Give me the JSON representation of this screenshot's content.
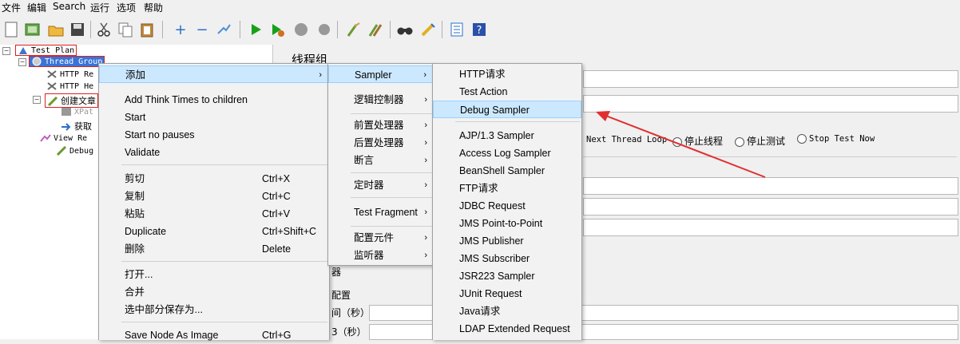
{
  "menubar": [
    "文件",
    "编辑",
    "Search",
    "运行",
    "选项",
    "帮助"
  ],
  "toolbar_icons": [
    "new-icon",
    "templates-icon",
    "open-icon",
    "save-icon",
    "cut-icon",
    "copy-icon",
    "paste-icon",
    "expand-icon",
    "collapse-icon",
    "toggle-icon",
    "start-icon",
    "start-no-pauses-icon",
    "stop-icon",
    "shutdown-icon",
    "clear-icon",
    "clear-all-icon",
    "search-icon",
    "reset-search-icon",
    "function-helper-icon",
    "help-icon"
  ],
  "tree": {
    "test_plan": "Test Plan",
    "thread_group": "Thread Group",
    "http_req": "HTTP Re",
    "http_hea": "HTTP He",
    "create_article": "创建文章",
    "xpath": "XPat",
    "fetch": "获取",
    "view_results": "View Re",
    "debug_sampler": "Debug S"
  },
  "right_panel": {
    "title": "线程组",
    "next_loop": "Next Thread Loop",
    "stop_thread": "停止线程",
    "stop_test": "停止测试",
    "stop_test_now": "Stop Test Now",
    "label_1": "器",
    "label_2": "配置",
    "label_3": "间（秒）",
    "label_4": "3（秒）"
  },
  "context_menu": {
    "add": "添加",
    "add_think_times": "Add Think Times to children",
    "start": "Start",
    "start_no_pauses": "Start no pauses",
    "validate": "Validate",
    "cut": "剪切",
    "cut_sc": "Ctrl+X",
    "copy": "复制",
    "copy_sc": "Ctrl+C",
    "paste": "粘贴",
    "paste_sc": "Ctrl+V",
    "duplicate": "Duplicate",
    "duplicate_sc": "Ctrl+Shift+C",
    "delete": "删除",
    "delete_sc": "Delete",
    "open": "打开...",
    "merge": "合并",
    "save_selection": "选中部分保存为...",
    "save_node_image": "Save Node As Image",
    "save_node_image_sc": "Ctrl+G"
  },
  "add_menu": {
    "sampler": "Sampler",
    "logic": "逻辑控制器",
    "pre": "前置处理器",
    "post": "后置处理器",
    "assert": "断言",
    "timer": "定时器",
    "fragment": "Test Fragment",
    "config": "配置元件",
    "listener": "监听器"
  },
  "sampler_menu": {
    "items": [
      "HTTP请求",
      "Test Action",
      "Debug Sampler",
      "AJP/1.3 Sampler",
      "Access Log Sampler",
      "BeanShell Sampler",
      "FTP请求",
      "JDBC Request",
      "JMS Point-to-Point",
      "JMS Publisher",
      "JMS Subscriber",
      "JSR223 Sampler",
      "JUnit Request",
      "Java请求",
      "LDAP Extended Request"
    ]
  },
  "colors": {
    "highlight": "#cce8ff",
    "selection": "#3874d8",
    "annotation": "#e03030"
  }
}
